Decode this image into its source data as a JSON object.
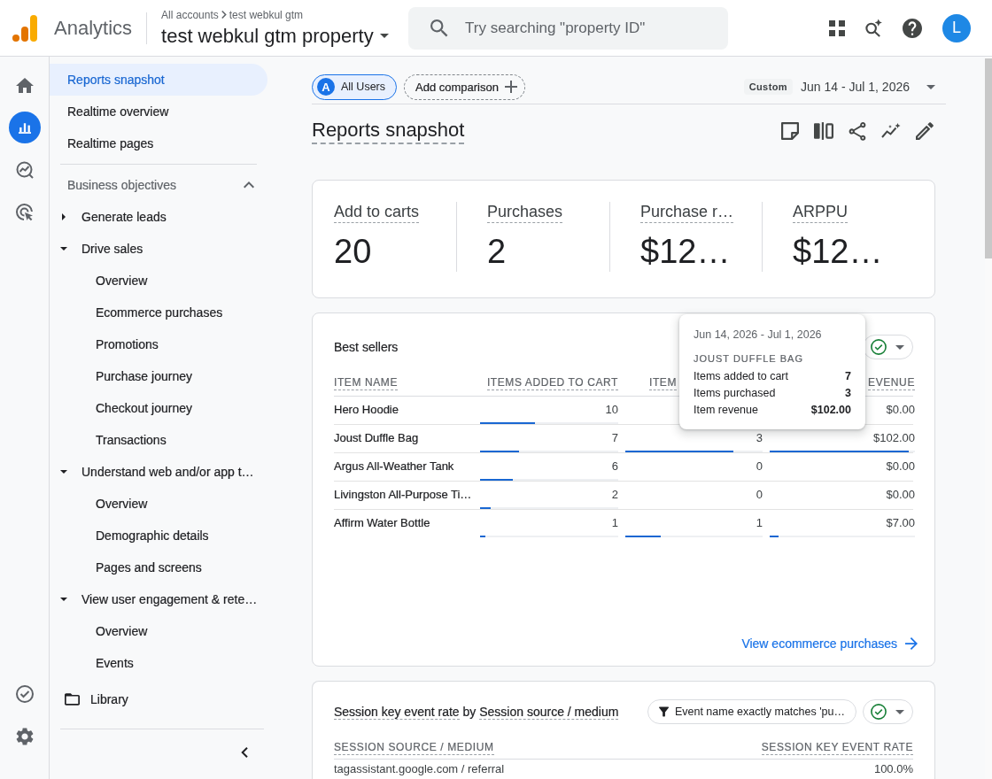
{
  "app_bar": {
    "product": "Analytics",
    "breadcrumb": [
      "All accounts",
      "test webkul gtm"
    ],
    "property": "test webkul gtm property",
    "search": {
      "placeholder": "Try searching \"property ID\""
    },
    "avatar_initial": "L"
  },
  "rail": {
    "top": [
      {
        "kind": "home",
        "selected": false
      },
      {
        "kind": "reports",
        "selected": true
      },
      {
        "kind": "explore",
        "selected": false
      },
      {
        "kind": "advertising",
        "selected": false
      }
    ],
    "bottom": [
      {
        "kind": "checklist",
        "selected": false
      },
      {
        "kind": "settings",
        "selected": false
      }
    ]
  },
  "nav": {
    "items": [
      {
        "label": "Reports snapshot",
        "selected": true
      },
      {
        "label": "Realtime overview",
        "selected": false
      },
      {
        "label": "Realtime pages",
        "selected": false
      }
    ],
    "sections": [
      {
        "label": "Business objectives",
        "expanded": true,
        "children": [
          {
            "label": "Generate leads",
            "expanded": false
          },
          {
            "label": "Drive sales",
            "expanded": true,
            "children": [
              {
                "label": "Overview",
                "selected": false
              },
              {
                "label": "Ecommerce purchases",
                "selected": false
              },
              {
                "label": "Promotions",
                "selected": false
              },
              {
                "label": "Purchase journey",
                "selected": false
              },
              {
                "label": "Checkout journey",
                "selected": false
              },
              {
                "label": "Transactions",
                "selected": false
              }
            ]
          },
          {
            "label": "Understand web and/or app t…",
            "expanded": true,
            "children": [
              {
                "label": "Overview",
                "selected": false
              },
              {
                "label": "Demographic details",
                "selected": false
              },
              {
                "label": "Pages and screens",
                "selected": false
              }
            ]
          },
          {
            "label": "View user engagement & rete…",
            "expanded": true,
            "children": [
              {
                "label": "Overview",
                "selected": false
              },
              {
                "label": "Events",
                "selected": false
              }
            ]
          }
        ]
      }
    ],
    "library": "Library"
  },
  "comparison_bar": {
    "segments": [
      {
        "badge": "A",
        "label": "All Users"
      }
    ],
    "add_comparison": "Add comparison",
    "date_preset": "Custom",
    "date_range": "Jun 14 - Jul 1, 2026"
  },
  "page_title": "Reports snapshot",
  "metrics": [
    {
      "label": "Add to carts",
      "value": "20"
    },
    {
      "label": "Purchases",
      "value": "2"
    },
    {
      "label": "Purchase r…",
      "value": "$12…"
    },
    {
      "label": "ARPPU",
      "value": "$12…"
    }
  ],
  "best_sellers": {
    "title": "Best sellers",
    "columns": [
      "ITEM NAME",
      "ITEMS ADDED TO CART",
      "ITEM",
      "EVENUE"
    ],
    "rows": [
      {
        "cells": [
          {
            "value": "Hero Hoodie"
          },
          {
            "value": "10",
            "level": 0.4
          },
          null,
          {
            "value": "$0.00"
          }
        ]
      },
      {
        "cells": [
          {
            "value": "Joust Duffle Bag"
          },
          {
            "value": "7",
            "level": 0.28
          },
          {
            "value": "3",
            "level": 0.79
          },
          {
            "value": "$102.00",
            "level": 0.96
          }
        ]
      },
      {
        "cells": [
          {
            "value": "Argus All-Weather Tank"
          },
          {
            "value": "6",
            "level": 0.24
          },
          {
            "value": "0"
          },
          {
            "value": "$0.00"
          }
        ]
      },
      {
        "cells": [
          {
            "value": "Livingston All-Purpose Ti…"
          },
          {
            "value": "2",
            "level": 0.08
          },
          {
            "value": "0"
          },
          {
            "value": "$0.00"
          }
        ]
      },
      {
        "cells": [
          {
            "value": "Affirm Water Bottle"
          },
          {
            "value": "1",
            "level": 0.04
          },
          {
            "value": "1",
            "level": 0.26
          },
          {
            "value": "$7.00",
            "level": 0.06
          }
        ]
      }
    ],
    "link": "View ecommerce purchases",
    "tooltip": {
      "date": "Jun 14, 2026 - Jul 1, 2026",
      "item": "JOUST DUFFLE BAG",
      "rows": [
        {
          "label": "Items added to cart",
          "value": "7"
        },
        {
          "label": "Items purchased",
          "value": "3"
        },
        {
          "label": "Item revenue",
          "value": "$102.00"
        }
      ]
    }
  },
  "session_card": {
    "title_parts": [
      {
        "text": "Session key event rate",
        "underlined": true
      },
      {
        "text": "by",
        "underlined": false
      },
      {
        "text": "Session source / medium",
        "underlined": true
      }
    ],
    "filter": "Event name exactly matches 'pu…",
    "columns": [
      "SESSION SOURCE / MEDIUM",
      "SESSION KEY EVENT RATE"
    ],
    "rows": [
      [
        "tagassistant.google.com / referral",
        "100.0%"
      ]
    ]
  }
}
